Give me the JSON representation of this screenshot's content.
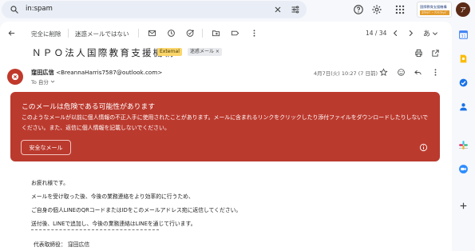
{
  "search": {
    "query": "in:spam"
  },
  "brand": {
    "line1": "国際教育支援機構",
    "line2": "ｽｸﾗｲﾊﾞｰ ｱﾝﾘﾐﾃｯﾄﾞ"
  },
  "profile": {
    "initial": "ア"
  },
  "toolbar": {
    "delete_forever": "完全に削除",
    "not_spam": "迷惑メールではない",
    "pagination": "14 / 34",
    "language": "あ"
  },
  "email": {
    "subject": "ＮＰＯ法人国際教育支援機構",
    "labels": [
      "External",
      "迷惑メール ×"
    ],
    "sender_name": "窪田広信",
    "sender_email": "<BreannaHarris7587@outlook.com>",
    "to": "To 自分",
    "date": "4月7日(火) 10:27 (7 日前)"
  },
  "warning": {
    "title": "このメールは危険である可能性があります",
    "body": "このようなメールが以前に個人情報の不正入手に使用されたことがあります。メールに含まれるリンクをクリックしたり添付ファイルをダウンロードしたりしないでください。また、返信に個人情報を記載しないでください。",
    "button": "安全なメール"
  },
  "body": {
    "lines": [
      "お疲れ様です。",
      "メールを受け取った後、今後の業務連絡をより効率的に行うため、",
      "ご自身の個人LINEのQRコードまたはIDをこのメールアドレス宛に返信してください。",
      "送付後、LINEで追加し、今後の業務連絡はLINEを通じて行います。"
    ],
    "signature": "代表取締役：  窪田広信"
  },
  "colors": {
    "warning_bg": "#bb3a2e",
    "external_label": "#fbd66b",
    "avatar": "#c0392b"
  }
}
